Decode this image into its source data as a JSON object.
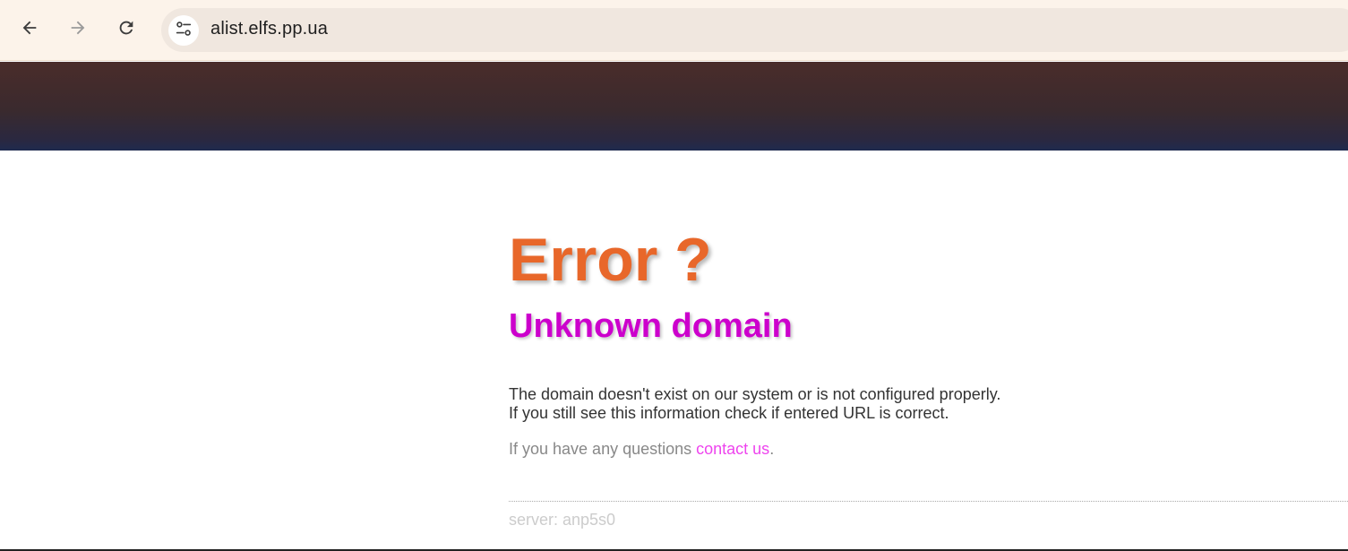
{
  "browser": {
    "url": "alist.elfs.pp.ua",
    "icons": {
      "back": "arrow-left-icon",
      "forward": "arrow-right-icon",
      "reload": "reload-icon",
      "site_info": "tune-icon"
    }
  },
  "page": {
    "title": "Error ?",
    "subtitle": "Unknown domain",
    "description_line1": "The domain doesn't exist on our system or is not configured properly.",
    "description_line2": "If you still see this information check if entered URL is correct.",
    "questions_prefix": "If you have any questions ",
    "contact_link": "contact us",
    "questions_suffix": ".",
    "server": "server: anp5s0"
  },
  "colors": {
    "title": "#e8672a",
    "subtitle": "#cc00cc",
    "link": "#ee44ee",
    "banner_top": "#4a2c2a",
    "banner_bottom": "#1f2a4e"
  }
}
